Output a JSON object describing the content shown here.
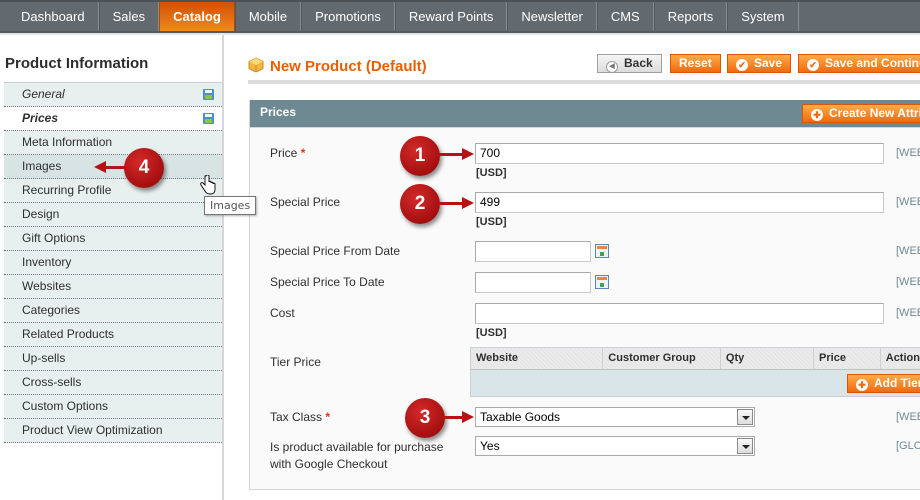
{
  "nav": {
    "items": [
      {
        "label": "Dashboard",
        "active": false
      },
      {
        "label": "Sales",
        "active": false
      },
      {
        "label": "Catalog",
        "active": true
      },
      {
        "label": "Mobile",
        "active": false
      },
      {
        "label": "Promotions",
        "active": false
      },
      {
        "label": "Reward Points",
        "active": false
      },
      {
        "label": "Newsletter",
        "active": false
      },
      {
        "label": "CMS",
        "active": false
      },
      {
        "label": "Reports",
        "active": false
      },
      {
        "label": "System",
        "active": false
      }
    ]
  },
  "sidebar": {
    "title": "Product Information",
    "items": [
      {
        "label": "General"
      },
      {
        "label": "Prices"
      },
      {
        "label": "Meta Information"
      },
      {
        "label": "Images"
      },
      {
        "label": "Recurring Profile"
      },
      {
        "label": "Design"
      },
      {
        "label": "Gift Options"
      },
      {
        "label": "Inventory"
      },
      {
        "label": "Websites"
      },
      {
        "label": "Categories"
      },
      {
        "label": "Related Products"
      },
      {
        "label": "Up-sells"
      },
      {
        "label": "Cross-sells"
      },
      {
        "label": "Custom Options"
      },
      {
        "label": "Product View Optimization"
      }
    ],
    "tooltip": "Images"
  },
  "header": {
    "title": "New Product (Default)",
    "buttons": {
      "back": "Back",
      "reset": "Reset",
      "save": "Save",
      "save_continue": "Save and Continue Edit"
    }
  },
  "prices": {
    "section_title": "Prices",
    "create_attribute": "Create New Attribute",
    "currency_note": "[USD]",
    "fields": {
      "price": {
        "label": "Price",
        "value": "700",
        "scope": "[WEBSITE]"
      },
      "special_price": {
        "label": "Special Price",
        "value": "499",
        "scope": "[WEBSITE]"
      },
      "special_from": {
        "label": "Special Price From Date",
        "value": "",
        "scope": "[WEBSITE]"
      },
      "special_to": {
        "label": "Special Price To Date",
        "value": "",
        "scope": "[WEBSITE]"
      },
      "cost": {
        "label": "Cost",
        "value": "",
        "scope": "[WEBSITE]"
      },
      "tier_price": {
        "label": "Tier Price"
      },
      "tax_class": {
        "label": "Tax Class",
        "value": "Taxable Goods",
        "scope": "[WEBSITE]"
      },
      "google_checkout": {
        "label_line1": "Is product available for purchase",
        "label_line2": "with Google Checkout",
        "value": "Yes",
        "scope": "[GLOBAL]"
      }
    },
    "required_mark": "*",
    "tier_table": {
      "columns": [
        "Website",
        "Customer Group",
        "Qty",
        "Price",
        "Action"
      ],
      "add_button": "Add Tier"
    }
  },
  "annotations": [
    "1",
    "2",
    "3",
    "4"
  ]
}
